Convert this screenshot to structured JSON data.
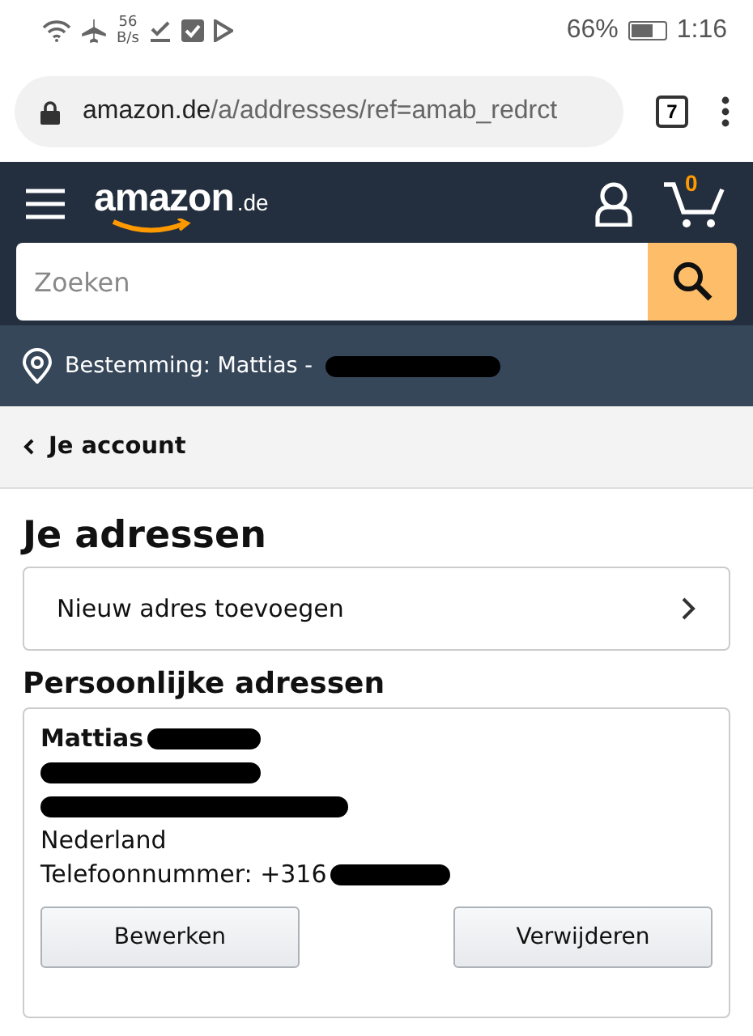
{
  "status_bar": {
    "speed_value": "56",
    "speed_unit": "B/s",
    "battery_percent": "66%",
    "time": "1:16"
  },
  "browser": {
    "url_domain": "amazon.de",
    "url_path": "/a/addresses/ref=amab_redrct",
    "tab_count": "7"
  },
  "header": {
    "logo_text": "amazon",
    "logo_suffix": ".de",
    "cart_count": "0",
    "search": {
      "placeholder": "Zoeken"
    }
  },
  "location": {
    "text": "Bestemming: Mattias -"
  },
  "breadcrumb": {
    "label": "Je account"
  },
  "page_title": "Je adressen",
  "add_address": {
    "label": "Nieuw adres toevoegen"
  },
  "section_title": "Persoonlijke adressen",
  "address": {
    "name": "Mattias",
    "country": "Nederland",
    "phone": "Telefoonnummer: +316",
    "buttons": [
      "Bewerken",
      "Verwijderen"
    ]
  }
}
